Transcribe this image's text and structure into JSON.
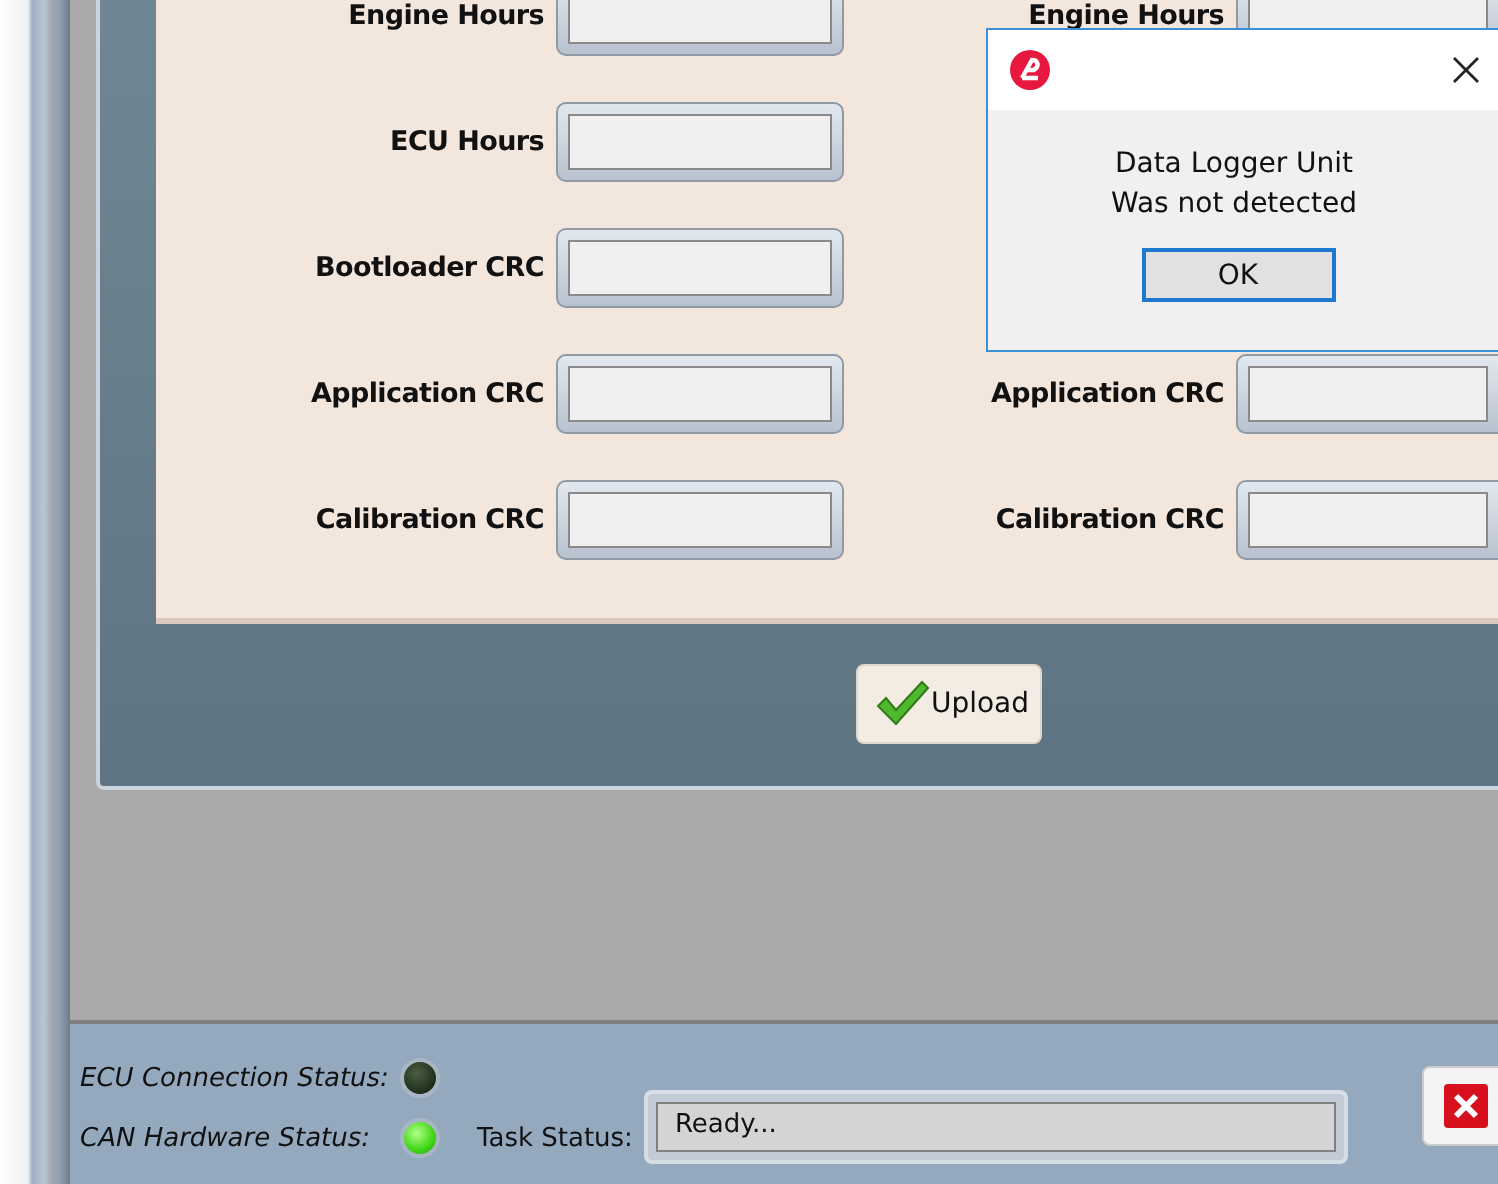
{
  "form": {
    "rows": [
      {
        "left": "Engine Hours",
        "right": "Engine Hours"
      },
      {
        "left": "ECU Hours"
      },
      {
        "left": "Bootloader CRC"
      },
      {
        "left": "Application CRC",
        "right": "Application CRC"
      },
      {
        "left": "Calibration CRC",
        "right": "Calibration CRC"
      }
    ],
    "upload_button": "Upload"
  },
  "status_bar": {
    "indicators": [
      {
        "label": "ECU Connection Status:",
        "on": false
      },
      {
        "label": "CAN Hardware Status:",
        "on": true
      }
    ],
    "task_status": {
      "label": "Task Status:",
      "value": "Ready..."
    }
  },
  "dialog": {
    "message": [
      "Data Logger Unit",
      "Was not detected"
    ],
    "button": "OK"
  }
}
